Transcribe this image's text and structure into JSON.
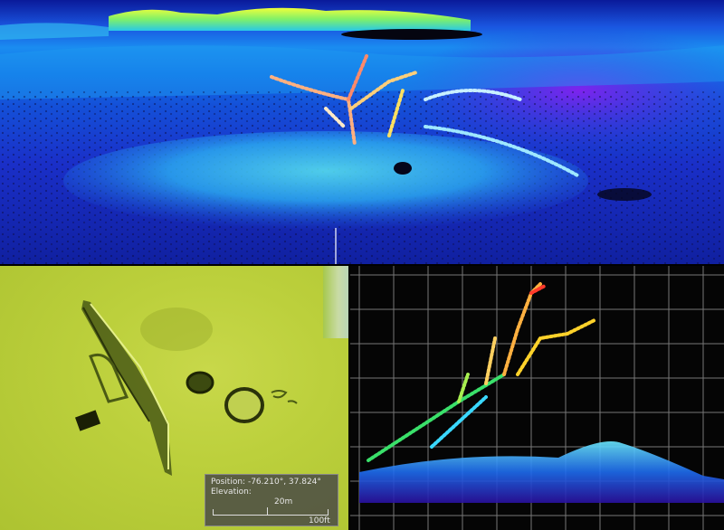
{
  "views": {
    "top": "3d-point-cloud",
    "bottom_left": "shaded-relief-map",
    "bottom_right": "profile-point-cloud"
  },
  "info_box": {
    "position_label": "Position:",
    "position_value": "-76.210°, 37.824°",
    "elevation_label": "Elevation:",
    "scale_metric": "20m",
    "scale_imperial": "100ft"
  },
  "colors": {
    "relief_ground": "#bcd03c",
    "profile_background": "#050505",
    "grid_line": "#8a8a8a",
    "cloud_high": "#ff3a2a",
    "cloud_mid": "#ffd22a",
    "cloud_low": "#3ad8ff"
  }
}
